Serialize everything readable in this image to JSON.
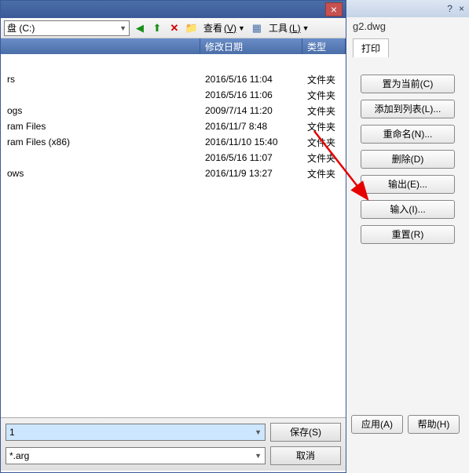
{
  "toolbar": {
    "drive_label": "盘 (C:)",
    "view_label": "查看",
    "tools_label": "工具",
    "view_hotkey": "(V)",
    "tools_hotkey": "(L)"
  },
  "columns": {
    "name": "",
    "date": "修改日期",
    "type": "类型"
  },
  "files": [
    {
      "name": "",
      "date": "",
      "type": ""
    },
    {
      "name": "rs",
      "date": "2016/5/16 11:04",
      "type": "文件夹"
    },
    {
      "name": "",
      "date": "2016/5/16 11:06",
      "type": "文件夹"
    },
    {
      "name": "ogs",
      "date": "2009/7/14 11:20",
      "type": "文件夹"
    },
    {
      "name": "ram Files",
      "date": "2016/11/7 8:48",
      "type": "文件夹"
    },
    {
      "name": "ram Files (x86)",
      "date": "2016/11/10 15:40",
      "type": "文件夹"
    },
    {
      "name": "",
      "date": "2016/5/16 11:07",
      "type": "文件夹"
    },
    {
      "name": "ows",
      "date": "2016/11/9 13:27",
      "type": "文件夹"
    }
  ],
  "dialog": {
    "filename_value": "1",
    "filter_value": "*.arg",
    "save_label": "保存(S)",
    "cancel_label": "取消"
  },
  "right": {
    "filename": "g2.dwg",
    "tab_print": "打印",
    "btns": {
      "set_current": "置为当前(C)",
      "add_to_list": "添加到列表(L)...",
      "rename": "重命名(N)...",
      "delete": "删除(D)",
      "export": "输出(E)...",
      "import": "输入(I)...",
      "reset": "重置(R)",
      "apply": "应用(A)",
      "help": "帮助(H)"
    }
  }
}
